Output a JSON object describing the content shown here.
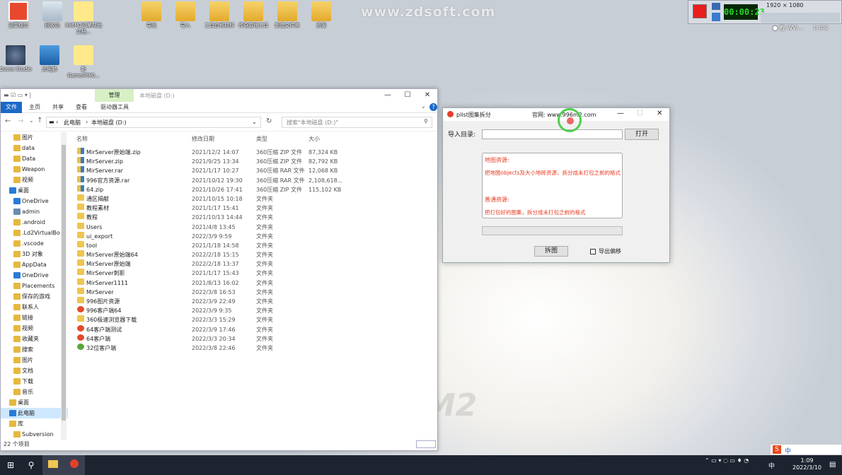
{
  "watermark": "www.zdsoft.com",
  "desktop": {
    "icons_row1": [
      "迅雷精灵",
      "回收站",
      "996M2引擎帮助文档...",
      "导出",
      "导入",
      "工具合格材料",
      "传奇游戏工具",
      "新建文件夹",
      "资源"
    ],
    "icons_row2": [
      "Cocos Studio",
      "此电脑",
      "新Game(PIM)..."
    ]
  },
  "recorder": {
    "time": "00:00:23",
    "resolution": "1920 × 1080",
    "extra": "● 截 WVi...",
    "file": "p.jpg"
  },
  "explorer": {
    "tab_manage": "管理",
    "title_path": "本地磁盘 (D:)",
    "ribbon": [
      "文件",
      "主页",
      "共享",
      "查看",
      "驱动器工具"
    ],
    "breadcrumb": [
      "此电脑",
      "本地磁盘 (D:)"
    ],
    "search_placeholder": "搜索\"本地磁盘 (D:)\"",
    "columns": [
      "名称",
      "修改日期",
      "类型",
      "大小"
    ],
    "nav": [
      {
        "label": "图片",
        "icon": "folder"
      },
      {
        "label": "data",
        "icon": "folder"
      },
      {
        "label": "Data",
        "icon": "folder"
      },
      {
        "label": "Weapon",
        "icon": "folder"
      },
      {
        "label": "视频",
        "icon": "folder"
      },
      {
        "label": "桌面",
        "icon": "desktop"
      },
      {
        "label": "OneDrive",
        "icon": "cloud"
      },
      {
        "label": "admin",
        "icon": "user"
      },
      {
        "label": ".android",
        "icon": "folder"
      },
      {
        "label": ".Ld2VirtualBo",
        "icon": "folder"
      },
      {
        "label": ".vscode",
        "icon": "folder"
      },
      {
        "label": "3D 对象",
        "icon": "folder"
      },
      {
        "label": "AppData",
        "icon": "folder"
      },
      {
        "label": "OneDrive",
        "icon": "cloud"
      },
      {
        "label": "Placements",
        "icon": "folder"
      },
      {
        "label": "保存的游戏",
        "icon": "folder"
      },
      {
        "label": "联系人",
        "icon": "folder"
      },
      {
        "label": "链接",
        "icon": "folder"
      },
      {
        "label": "视频",
        "icon": "folder"
      },
      {
        "label": "收藏夹",
        "icon": "folder"
      },
      {
        "label": "搜索",
        "icon": "folder"
      },
      {
        "label": "图片",
        "icon": "folder"
      },
      {
        "label": "文档",
        "icon": "folder"
      },
      {
        "label": "下载",
        "icon": "folder"
      },
      {
        "label": "音乐",
        "icon": "folder"
      },
      {
        "label": "桌面",
        "icon": "folder"
      },
      {
        "label": "此电脑",
        "icon": "pc"
      },
      {
        "label": "库",
        "icon": "folder"
      },
      {
        "label": "Subversion",
        "icon": "folder"
      }
    ],
    "files": [
      {
        "name": "MirServer原始端.zip",
        "date": "2021/12/2 14:07",
        "type": "360压缩 ZIP 文件",
        "size": "87,324 KB",
        "icon": "zip"
      },
      {
        "name": "MirServer.zip",
        "date": "2021/9/25 13:34",
        "type": "360压缩 ZIP 文件",
        "size": "82,792 KB",
        "icon": "zip"
      },
      {
        "name": "MirServer.rar",
        "date": "2021/1/17 10:27",
        "type": "360压缩 RAR 文件",
        "size": "12,068 KB",
        "icon": "zip"
      },
      {
        "name": "996官方资源.rar",
        "date": "2021/10/12 19:30",
        "type": "360压缩 RAR 文件",
        "size": "2,108,618...",
        "icon": "zip"
      },
      {
        "name": "64.zip",
        "date": "2021/10/26 17:41",
        "type": "360压缩 ZIP 文件",
        "size": "115,102 KB",
        "icon": "zip"
      },
      {
        "name": "通区揭献",
        "date": "2021/10/15 10:18",
        "type": "文件夹",
        "size": "",
        "icon": "fold"
      },
      {
        "name": "教程素材",
        "date": "2021/1/17 15:41",
        "type": "文件夹",
        "size": "",
        "icon": "fold"
      },
      {
        "name": "教程",
        "date": "2021/10/13 14:44",
        "type": "文件夹",
        "size": "",
        "icon": "fold"
      },
      {
        "name": "Users",
        "date": "2021/4/8 13:45",
        "type": "文件夹",
        "size": "",
        "icon": "fold"
      },
      {
        "name": "ui_export",
        "date": "2022/3/9 9:59",
        "type": "文件夹",
        "size": "",
        "icon": "fold"
      },
      {
        "name": "tool",
        "date": "2021/1/18 14:58",
        "type": "文件夹",
        "size": "",
        "icon": "fold"
      },
      {
        "name": "MirServer原始端64",
        "date": "2022/2/18 15:15",
        "type": "文件夹",
        "size": "",
        "icon": "fold"
      },
      {
        "name": "MirServer原始端",
        "date": "2022/2/18 13:37",
        "type": "文件夹",
        "size": "",
        "icon": "fold"
      },
      {
        "name": "MirServer刺影",
        "date": "2021/1/17 15:43",
        "type": "文件夹",
        "size": "",
        "icon": "fold"
      },
      {
        "name": "MirServer1111",
        "date": "2021/8/13 16:02",
        "type": "文件夹",
        "size": "",
        "icon": "fold"
      },
      {
        "name": "MirServer",
        "date": "2022/3/8 16:53",
        "type": "文件夹",
        "size": "",
        "icon": "fold"
      },
      {
        "name": "996图片资源",
        "date": "2022/3/9 22:49",
        "type": "文件夹",
        "size": "",
        "icon": "fold"
      },
      {
        "name": "996客户端64",
        "date": "2022/3/9 9:35",
        "type": "文件夹",
        "size": "",
        "icon": "o360"
      },
      {
        "name": "360极速浏览器下载",
        "date": "2022/3/3 15:29",
        "type": "文件夹",
        "size": "",
        "icon": "fold"
      },
      {
        "name": "64客户端测试",
        "date": "2022/3/9 17:46",
        "type": "文件夹",
        "size": "",
        "icon": "o360"
      },
      {
        "name": "64客户端",
        "date": "2022/3/3 20:34",
        "type": "文件夹",
        "size": "",
        "icon": "o360"
      },
      {
        "name": "32位客户端",
        "date": "2022/3/8 22:46",
        "type": "文件夹",
        "size": "",
        "icon": "g360"
      }
    ],
    "status": "22 个项目"
  },
  "dialog": {
    "title": "plist图集拆分",
    "website": "官网: www.996m2.com",
    "import_label": "导入目录:",
    "import_value": "",
    "open_button": "打开",
    "map_title": "地图资源:",
    "map_desc": "把地图objects及大小地砖资源，拆分成未打包之前的格式",
    "normal_title": "普通资源:",
    "normal_desc": "把打包好的图集，拆分成未打包之前的格式",
    "split_button": "拆图",
    "export_offset": "导出偏移"
  },
  "taskbar": {
    "ime": "中",
    "clock_time": "1:09",
    "clock_date": "2022/3/10",
    "tray_lang": "中"
  }
}
